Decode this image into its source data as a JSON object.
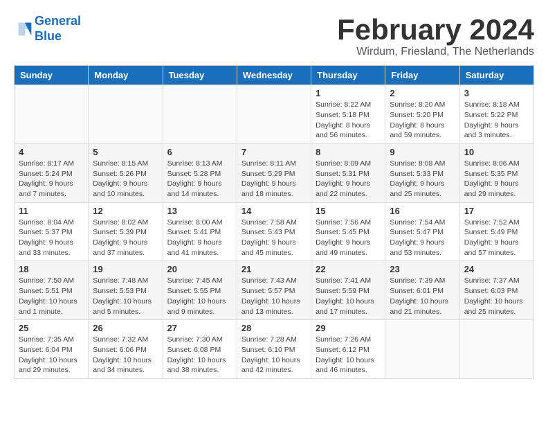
{
  "header": {
    "logo_line1": "General",
    "logo_line2": "Blue",
    "month_title": "February 2024",
    "subtitle": "Wirdum, Friesland, The Netherlands"
  },
  "weekdays": [
    "Sunday",
    "Monday",
    "Tuesday",
    "Wednesday",
    "Thursday",
    "Friday",
    "Saturday"
  ],
  "weeks": [
    [
      {
        "day": "",
        "info": ""
      },
      {
        "day": "",
        "info": ""
      },
      {
        "day": "",
        "info": ""
      },
      {
        "day": "",
        "info": ""
      },
      {
        "day": "1",
        "info": "Sunrise: 8:22 AM\nSunset: 5:18 PM\nDaylight: 8 hours\nand 56 minutes."
      },
      {
        "day": "2",
        "info": "Sunrise: 8:20 AM\nSunset: 5:20 PM\nDaylight: 8 hours\nand 59 minutes."
      },
      {
        "day": "3",
        "info": "Sunrise: 8:18 AM\nSunset: 5:22 PM\nDaylight: 9 hours\nand 3 minutes."
      }
    ],
    [
      {
        "day": "4",
        "info": "Sunrise: 8:17 AM\nSunset: 5:24 PM\nDaylight: 9 hours\nand 7 minutes."
      },
      {
        "day": "5",
        "info": "Sunrise: 8:15 AM\nSunset: 5:26 PM\nDaylight: 9 hours\nand 10 minutes."
      },
      {
        "day": "6",
        "info": "Sunrise: 8:13 AM\nSunset: 5:28 PM\nDaylight: 9 hours\nand 14 minutes."
      },
      {
        "day": "7",
        "info": "Sunrise: 8:11 AM\nSunset: 5:29 PM\nDaylight: 9 hours\nand 18 minutes."
      },
      {
        "day": "8",
        "info": "Sunrise: 8:09 AM\nSunset: 5:31 PM\nDaylight: 9 hours\nand 22 minutes."
      },
      {
        "day": "9",
        "info": "Sunrise: 8:08 AM\nSunset: 5:33 PM\nDaylight: 9 hours\nand 25 minutes."
      },
      {
        "day": "10",
        "info": "Sunrise: 8:06 AM\nSunset: 5:35 PM\nDaylight: 9 hours\nand 29 minutes."
      }
    ],
    [
      {
        "day": "11",
        "info": "Sunrise: 8:04 AM\nSunset: 5:37 PM\nDaylight: 9 hours\nand 33 minutes."
      },
      {
        "day": "12",
        "info": "Sunrise: 8:02 AM\nSunset: 5:39 PM\nDaylight: 9 hours\nand 37 minutes."
      },
      {
        "day": "13",
        "info": "Sunrise: 8:00 AM\nSunset: 5:41 PM\nDaylight: 9 hours\nand 41 minutes."
      },
      {
        "day": "14",
        "info": "Sunrise: 7:58 AM\nSunset: 5:43 PM\nDaylight: 9 hours\nand 45 minutes."
      },
      {
        "day": "15",
        "info": "Sunrise: 7:56 AM\nSunset: 5:45 PM\nDaylight: 9 hours\nand 49 minutes."
      },
      {
        "day": "16",
        "info": "Sunrise: 7:54 AM\nSunset: 5:47 PM\nDaylight: 9 hours\nand 53 minutes."
      },
      {
        "day": "17",
        "info": "Sunrise: 7:52 AM\nSunset: 5:49 PM\nDaylight: 9 hours\nand 57 minutes."
      }
    ],
    [
      {
        "day": "18",
        "info": "Sunrise: 7:50 AM\nSunset: 5:51 PM\nDaylight: 10 hours\nand 1 minute."
      },
      {
        "day": "19",
        "info": "Sunrise: 7:48 AM\nSunset: 5:53 PM\nDaylight: 10 hours\nand 5 minutes."
      },
      {
        "day": "20",
        "info": "Sunrise: 7:45 AM\nSunset: 5:55 PM\nDaylight: 10 hours\nand 9 minutes."
      },
      {
        "day": "21",
        "info": "Sunrise: 7:43 AM\nSunset: 5:57 PM\nDaylight: 10 hours\nand 13 minutes."
      },
      {
        "day": "22",
        "info": "Sunrise: 7:41 AM\nSunset: 5:59 PM\nDaylight: 10 hours\nand 17 minutes."
      },
      {
        "day": "23",
        "info": "Sunrise: 7:39 AM\nSunset: 6:01 PM\nDaylight: 10 hours\nand 21 minutes."
      },
      {
        "day": "24",
        "info": "Sunrise: 7:37 AM\nSunset: 6:03 PM\nDaylight: 10 hours\nand 25 minutes."
      }
    ],
    [
      {
        "day": "25",
        "info": "Sunrise: 7:35 AM\nSunset: 6:04 PM\nDaylight: 10 hours\nand 29 minutes."
      },
      {
        "day": "26",
        "info": "Sunrise: 7:32 AM\nSunset: 6:06 PM\nDaylight: 10 hours\nand 34 minutes."
      },
      {
        "day": "27",
        "info": "Sunrise: 7:30 AM\nSunset: 6:08 PM\nDaylight: 10 hours\nand 38 minutes."
      },
      {
        "day": "28",
        "info": "Sunrise: 7:28 AM\nSunset: 6:10 PM\nDaylight: 10 hours\nand 42 minutes."
      },
      {
        "day": "29",
        "info": "Sunrise: 7:26 AM\nSunset: 6:12 PM\nDaylight: 10 hours\nand 46 minutes."
      },
      {
        "day": "",
        "info": ""
      },
      {
        "day": "",
        "info": ""
      }
    ]
  ]
}
